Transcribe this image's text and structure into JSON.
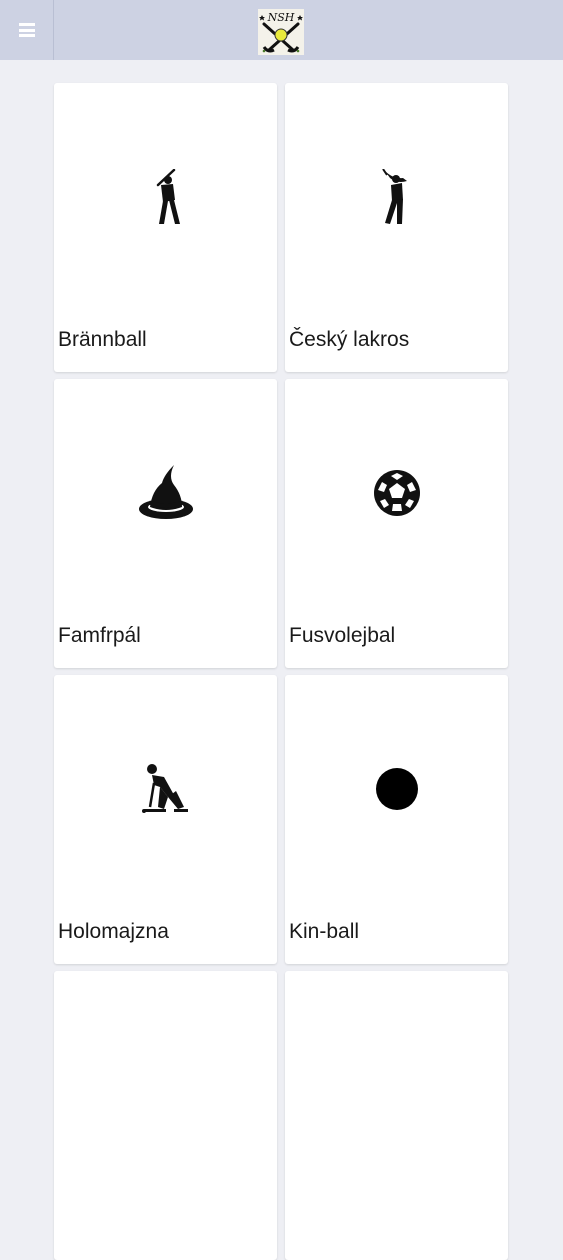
{
  "header": {
    "menu_icon": "hamburger-menu-icon",
    "logo_icon": "nsh-logo-crossed-sticks-ball",
    "bar_color": "#cdd2e3"
  },
  "sports": [
    {
      "label": "Brännball",
      "icon": "batter-icon"
    },
    {
      "label": "Český lakros",
      "icon": "golfer-icon"
    },
    {
      "label": "Famfrpál",
      "icon": "witch-hat-icon"
    },
    {
      "label": "Fusvolejbal",
      "icon": "soccer-ball-icon"
    },
    {
      "label": "Holomajzna",
      "icon": "hockey-player-icon"
    },
    {
      "label": "Kin-ball",
      "icon": "ball-icon"
    },
    {
      "label": "",
      "icon": ""
    },
    {
      "label": "",
      "icon": ""
    }
  ]
}
